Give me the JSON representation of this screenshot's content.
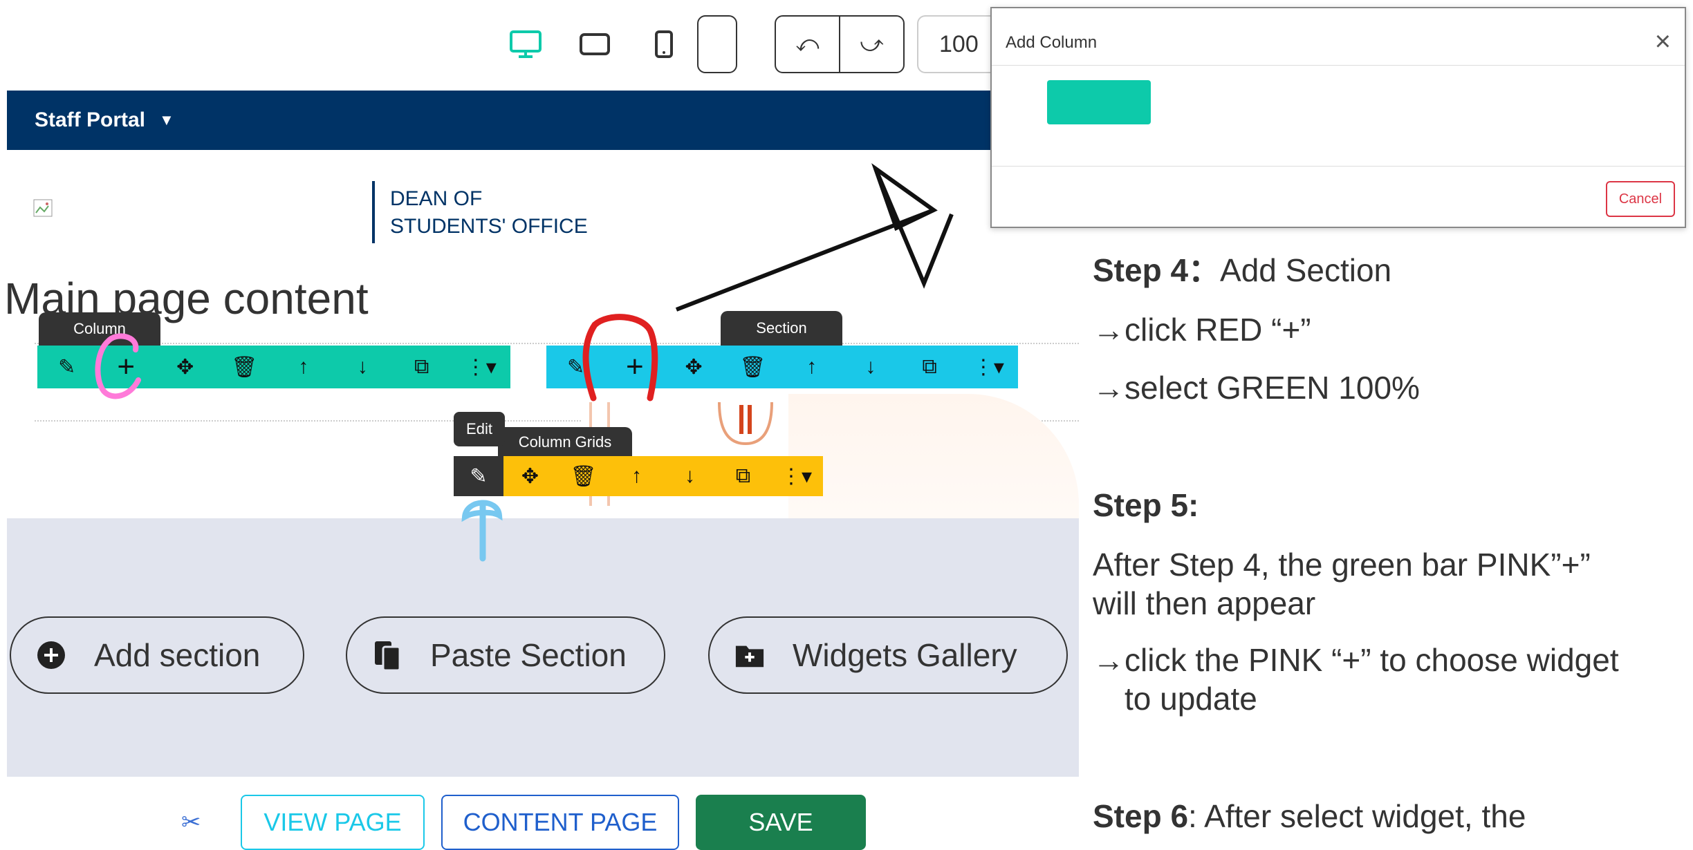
{
  "toolbar_top": {
    "zoom_value": "100",
    "undo_icon": "undo-icon",
    "redo_icon": "redo-icon"
  },
  "navbar": {
    "title": "Staff Portal"
  },
  "header": {
    "dean_line1": "DEAN OF",
    "dean_line2": "STUDENTS' OFFICE"
  },
  "main": {
    "title": "Main page content"
  },
  "tooltips": {
    "column": "Column",
    "section": "Section",
    "edit": "Edit",
    "column_grids": "Column Grids"
  },
  "add_area": {
    "add_section": "Add section",
    "paste_section": "Paste Section",
    "widgets_gallery": "Widgets Gallery"
  },
  "bottom": {
    "view_page": "VIEW PAGE",
    "content_page": "CONTENT PAGE",
    "save": "SAVE"
  },
  "modal": {
    "title": "Add Column",
    "cancel": "Cancel"
  },
  "instructions": {
    "step4_label": "Step 4",
    "step4_colon": "：",
    "step4_text": "Add Section",
    "step4_a": "→click RED “+”",
    "step4_b": "→select GREEN 100%",
    "step5_label": "Step 5:",
    "step5_text1": "After Step 4, the green bar PINK”+”",
    "step5_text2": "will then appear",
    "step5_c1": "→click the PINK “+” to choose widget",
    "step5_c2": "to update",
    "step6_label": "Step 6",
    "step6_text": ":  After select widget, the"
  },
  "colors": {
    "navy": "#003366",
    "teal": "#0dcaaa",
    "cyan": "#1ac8e8",
    "amber": "#fdc00a",
    "grey_area": "#e1e4ee",
    "save_green": "#1a7f4e",
    "annot_pink": "#ff7ad9",
    "annot_red": "#e02020",
    "annot_blue": "#78c8f0"
  }
}
